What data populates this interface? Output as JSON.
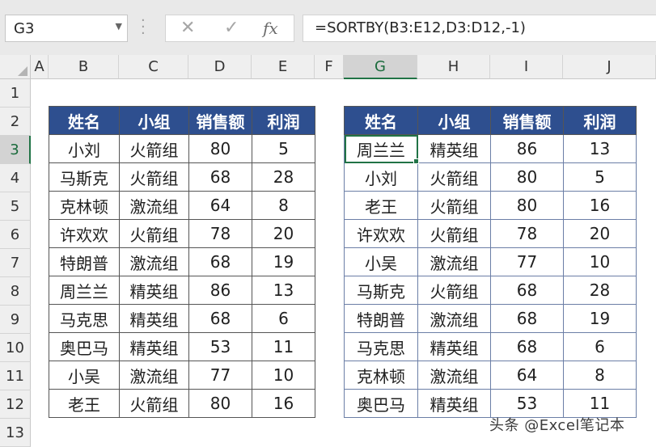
{
  "formula_bar": {
    "name_box": "G3",
    "cancel_icon": "✕",
    "enter_icon": "✓",
    "fx_label": "fx",
    "formula": "=SORTBY(B3:E12,D3:D12,-1)"
  },
  "columns": [
    "A",
    "B",
    "C",
    "D",
    "E",
    "F",
    "G",
    "H",
    "I",
    "J"
  ],
  "rows": [
    "1",
    "2",
    "3",
    "4",
    "5",
    "6",
    "7",
    "8",
    "9",
    "10",
    "11",
    "12",
    "13"
  ],
  "selected_cell": "G3",
  "headers": [
    "姓名",
    "小组",
    "销售额",
    "利润"
  ],
  "source_table": [
    [
      "小刘",
      "火箭组",
      "80",
      "5"
    ],
    [
      "马斯克",
      "火箭组",
      "68",
      "28"
    ],
    [
      "克林顿",
      "激流组",
      "64",
      "8"
    ],
    [
      "许欢欢",
      "火箭组",
      "78",
      "20"
    ],
    [
      "特朗普",
      "激流组",
      "68",
      "19"
    ],
    [
      "周兰兰",
      "精英组",
      "86",
      "13"
    ],
    [
      "马克思",
      "精英组",
      "68",
      "6"
    ],
    [
      "奥巴马",
      "精英组",
      "53",
      "11"
    ],
    [
      "小吴",
      "激流组",
      "77",
      "10"
    ],
    [
      "老王",
      "火箭组",
      "80",
      "16"
    ]
  ],
  "sorted_table": [
    [
      "周兰兰",
      "精英组",
      "86",
      "13"
    ],
    [
      "小刘",
      "火箭组",
      "80",
      "5"
    ],
    [
      "老王",
      "火箭组",
      "80",
      "16"
    ],
    [
      "许欢欢",
      "火箭组",
      "78",
      "20"
    ],
    [
      "小吴",
      "激流组",
      "77",
      "10"
    ],
    [
      "马斯克",
      "火箭组",
      "68",
      "28"
    ],
    [
      "特朗普",
      "激流组",
      "68",
      "19"
    ],
    [
      "马克思",
      "精英组",
      "68",
      "6"
    ],
    [
      "克林顿",
      "激流组",
      "64",
      "8"
    ],
    [
      "奥巴马",
      "精英组",
      "53",
      "11"
    ]
  ],
  "watermark": "头条 @Excel笔记本",
  "colors": {
    "header_fill": "#2e4f8f",
    "selection": "#217346"
  }
}
